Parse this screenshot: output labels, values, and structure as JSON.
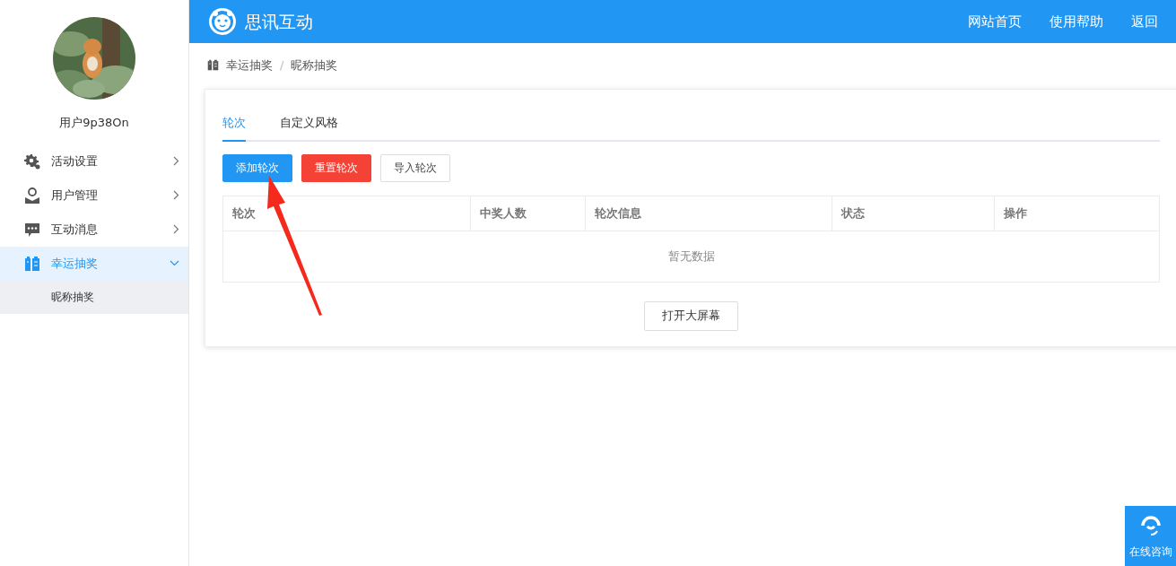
{
  "sidebar": {
    "user": {
      "name": "用户9p38On"
    },
    "menu": [
      {
        "label": "活动设置",
        "selected": false,
        "expanded": false
      },
      {
        "label": "用户管理",
        "selected": false,
        "expanded": false
      },
      {
        "label": "互动消息",
        "selected": false,
        "expanded": false
      },
      {
        "label": "幸运抽奖",
        "selected": true,
        "expanded": true,
        "children": [
          {
            "label": "昵称抽奖",
            "selected": true
          }
        ]
      }
    ]
  },
  "header": {
    "brand": "思讯互动",
    "links": [
      "网站首页",
      "使用帮助",
      "返回"
    ]
  },
  "breadcrumb": [
    "幸运抽奖",
    "昵称抽奖"
  ],
  "breadcrumb_separator": "/",
  "tabs": [
    {
      "label": "轮次",
      "selected": true
    },
    {
      "label": "自定义风格",
      "selected": false
    }
  ],
  "buttons": [
    {
      "label": "添加轮次",
      "kind": "primary"
    },
    {
      "label": "重置轮次",
      "kind": "danger"
    },
    {
      "label": "导入轮次",
      "kind": "plain"
    }
  ],
  "table": {
    "columns": [
      "轮次",
      "中奖人数",
      "轮次信息",
      "状态",
      "操作"
    ],
    "empty_text": "暂无数据"
  },
  "screen_button": "打开大屏幕",
  "consult": {
    "label": "在线咨询"
  }
}
